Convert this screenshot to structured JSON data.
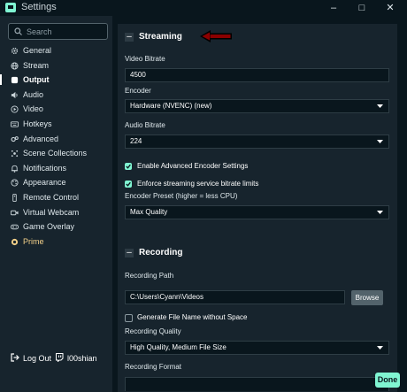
{
  "window": {
    "title": "Settings",
    "minimize": "–",
    "maximize": "□",
    "close": "✕"
  },
  "search": {
    "placeholder": "Search"
  },
  "sidebar": {
    "items": [
      {
        "label": "General",
        "icon": "gear-icon"
      },
      {
        "label": "Stream",
        "icon": "globe-icon"
      },
      {
        "label": "Output",
        "icon": "output-icon",
        "active": true
      },
      {
        "label": "Audio",
        "icon": "speaker-icon"
      },
      {
        "label": "Video",
        "icon": "video-icon"
      },
      {
        "label": "Hotkeys",
        "icon": "keyboard-icon"
      },
      {
        "label": "Advanced",
        "icon": "advanced-gears-icon"
      },
      {
        "label": "Scene Collections",
        "icon": "scenes-icon"
      },
      {
        "label": "Notifications",
        "icon": "bell-icon"
      },
      {
        "label": "Appearance",
        "icon": "palette-icon"
      },
      {
        "label": "Remote Control",
        "icon": "remote-icon"
      },
      {
        "label": "Virtual Webcam",
        "icon": "webcam-icon"
      },
      {
        "label": "Game Overlay",
        "icon": "gamepad-icon"
      },
      {
        "label": "Prime",
        "icon": "prime-icon"
      }
    ],
    "logout": "Log Out",
    "username": "l00shian"
  },
  "streaming": {
    "title": "Streaming",
    "video_bitrate_label": "Video Bitrate",
    "video_bitrate_value": "4500",
    "encoder_label": "Encoder",
    "encoder_value": "Hardware (NVENC) (new)",
    "audio_bitrate_label": "Audio Bitrate",
    "audio_bitrate_value": "224",
    "advanced_encoder_label": "Enable Advanced Encoder Settings",
    "advanced_encoder_checked": true,
    "enforce_limits_label": "Enforce streaming service bitrate limits",
    "enforce_limits_checked": true,
    "preset_label": "Encoder Preset (higher = less CPU)",
    "preset_value": "Max Quality"
  },
  "recording": {
    "title": "Recording",
    "path_label": "Recording Path",
    "path_value": "C:\\Users\\Cyann\\Videos",
    "browse_label": "Browse",
    "no_space_label": "Generate File Name without Space",
    "no_space_checked": false,
    "quality_label": "Recording Quality",
    "quality_value": "High Quality, Medium File Size",
    "format_label": "Recording Format"
  },
  "footer": {
    "done_label": "Done"
  },
  "colors": {
    "accent": "#80f5d2",
    "panel": "#17242d",
    "background": "#09161d",
    "arrow": "#8b0000"
  }
}
